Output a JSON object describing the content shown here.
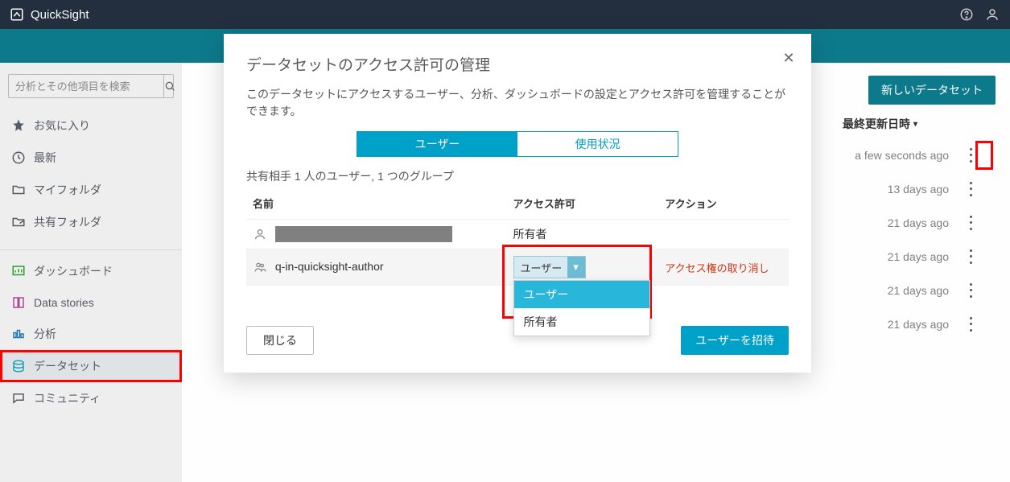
{
  "brand": "QuickSight",
  "search": {
    "placeholder": "分析とその他項目を検索"
  },
  "nav": {
    "favorites": "お気に入り",
    "recent": "最新",
    "my_folders": "マイフォルダ",
    "shared_folders": "共有フォルダ",
    "dashboards": "ダッシュボード",
    "data_stories": "Data stories",
    "analyses": "分析",
    "datasets": "データセット",
    "community": "コミュニティ"
  },
  "main": {
    "new_dataset_btn": "新しいデータセット",
    "col_last_updated": "最終更新日時",
    "rows": [
      {
        "time": "a few seconds ago"
      },
      {
        "time": "13 days ago"
      },
      {
        "time": "21 days ago"
      },
      {
        "time": "21 days ago"
      },
      {
        "time": "21 days ago"
      },
      {
        "time": "21 days ago"
      }
    ]
  },
  "modal": {
    "title": "データセットのアクセス許可の管理",
    "desc": "このデータセットにアクセスするユーザー、分析、ダッシュボードの設定とアクセス許可を管理することができます。",
    "tab_users": "ユーザー",
    "tab_usage": "使用状況",
    "share_summary": "共有相手 1 人のユーザー, 1 つのグループ",
    "col_name": "名前",
    "col_perm": "アクセス許可",
    "col_action": "アクション",
    "row_owner_perm": "所有者",
    "row_group_name": "q-in-quicksight-author",
    "revoke": "アクセス権の取り消し",
    "select_value": "ユーザー",
    "dropdown_opt_user": "ユーザー",
    "dropdown_opt_owner": "所有者",
    "close_btn": "閉じる",
    "invite_btn": "ユーザーを招待"
  }
}
